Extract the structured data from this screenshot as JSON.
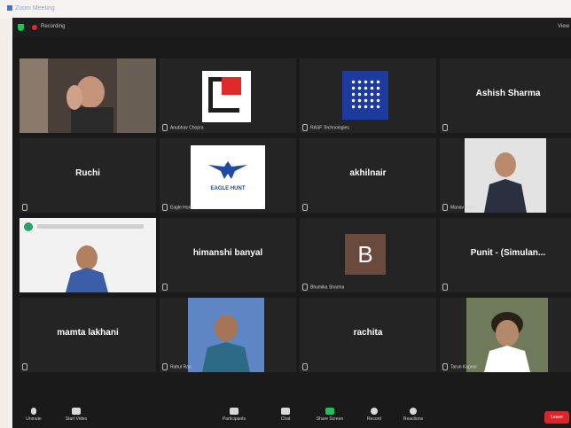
{
  "window": {
    "title": "Zoom Meeting"
  },
  "topbar": {
    "recording_label": "Recording",
    "view_label": "View"
  },
  "participants": [
    {
      "tile_name": "",
      "label": "",
      "video": "camera-woman-hand-raised"
    },
    {
      "tile_name": "",
      "label": "Anubhav Chopra",
      "video": "logo-red-black"
    },
    {
      "tile_name": "",
      "label": "RASF Technologies",
      "video": "logo-blue-dots"
    },
    {
      "tile_name": "Ashish Sharma",
      "label": ""
    },
    {
      "tile_name": "Ruchi",
      "label": ""
    },
    {
      "tile_name": "",
      "label": "Eagle Hunt",
      "video": "logo-eagle-hunt",
      "logo_text": "EAGLE HUNT"
    },
    {
      "tile_name": "akhilnair",
      "label": ""
    },
    {
      "tile_name": "",
      "label": "Manav Mittal",
      "video": "camera-man-suit"
    },
    {
      "tile_name": "",
      "label": "",
      "video": "camera-woman-shared-screen"
    },
    {
      "tile_name": "himanshi banyal",
      "label": ""
    },
    {
      "tile_name": "",
      "label": "Bhumika Sharma",
      "video": "avatar-letter",
      "avatar_letter": "B"
    },
    {
      "tile_name": "Punit - (Simulan...",
      "label": ""
    },
    {
      "tile_name": "mamta lakhani",
      "label": ""
    },
    {
      "tile_name": "",
      "label": "Rahul Rao",
      "video": "camera-man-blue-bg"
    },
    {
      "tile_name": "rachita",
      "label": ""
    },
    {
      "tile_name": "",
      "label": "Tarun Kapoor",
      "video": "camera-man-curly-hair"
    }
  ],
  "toolbar": {
    "buttons": [
      {
        "name": "unmute-button",
        "label": "Unmute",
        "icon": "microphone-icon"
      },
      {
        "name": "start-video-button",
        "label": "Start Video",
        "icon": "video-camera-icon"
      },
      {
        "name": "participants-button",
        "label": "Participants",
        "icon": "people-icon"
      },
      {
        "name": "chat-button",
        "label": "Chat",
        "icon": "chat-icon"
      },
      {
        "name": "share-screen-button",
        "label": "Share Screen",
        "icon": "share-screen-icon"
      },
      {
        "name": "record-button",
        "label": "Record",
        "icon": "record-icon"
      },
      {
        "name": "reactions-button",
        "label": "Reactions",
        "icon": "reactions-icon"
      }
    ],
    "end_label": "Leave"
  },
  "colors": {
    "active_speaker": "#c6d33a",
    "share_green": "#20c05a",
    "end_red": "#d9262a",
    "tile_bg": "#242424"
  }
}
